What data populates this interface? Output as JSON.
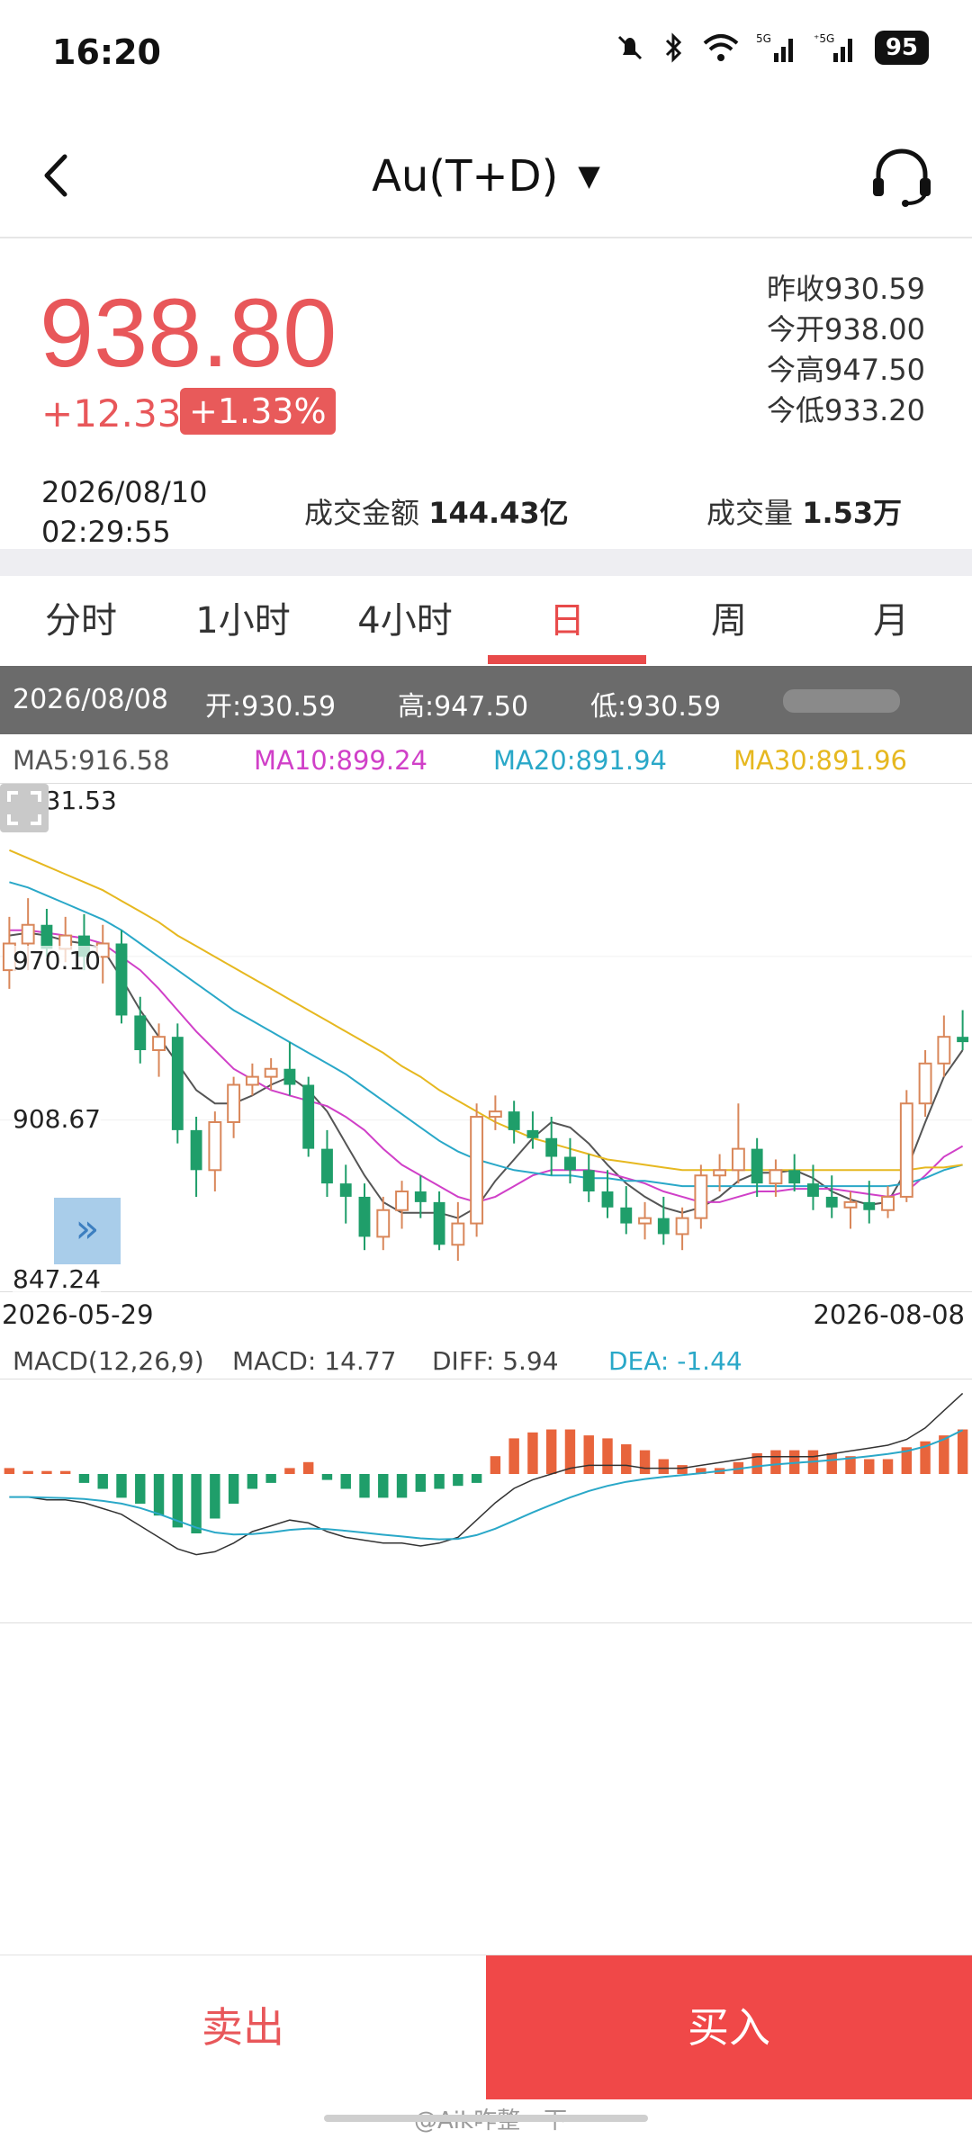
{
  "status_bar": {
    "time": "16:20",
    "battery": "95"
  },
  "header": {
    "title": "Au(T+D)",
    "caret": "▼"
  },
  "quote": {
    "price": "938.80",
    "change": "+12.33",
    "change_pct": "+1.33%",
    "prev_close": "昨收930.59",
    "open": "今开938.00",
    "high": "今高947.50",
    "low": "今低933.20",
    "date": "2026/08/10",
    "time": "02:29:55",
    "amount_label": "成交金额",
    "amount_value": "144.43亿",
    "volume_label": "成交量",
    "volume_value": "1.53万"
  },
  "tabs": [
    {
      "label": "分时"
    },
    {
      "label": "1小时"
    },
    {
      "label": "4小时"
    },
    {
      "label": "日",
      "active": true
    },
    {
      "label": "周"
    },
    {
      "label": "月"
    }
  ],
  "info_bar": {
    "date": "2026/08/08",
    "open": "开:930.59",
    "high": "高:947.50",
    "low": "低:930.59"
  },
  "ma": {
    "ma5": "MA5:916.58",
    "ma10": "MA10:899.24",
    "ma20": "MA20:891.94",
    "ma30": "MA30:891.96",
    "colors": {
      "ma5": "#555555",
      "ma10": "#d040c8",
      "ma20": "#2aa8c8",
      "ma30": "#e6b820"
    }
  },
  "axis": {
    "y_ticks": [
      "1031.53",
      "970.10",
      "908.67",
      "847.24"
    ],
    "x_start": "2026-05-29",
    "x_end": "2026-08-08"
  },
  "macd": {
    "label": "MACD(12,26,9)",
    "macd": "MACD: 14.77",
    "diff": "DIFF: 5.94",
    "dea": "DEA: -1.44"
  },
  "actions": {
    "sell": "卖出",
    "buy": "买入"
  },
  "watermark": "@Aik咋整一下",
  "colors": {
    "up": "#d9875a",
    "down": "#1f9e6a",
    "price": "#e8575a",
    "buy_bg": "#f04848"
  },
  "chart_data": {
    "type": "candlestick",
    "ylim": [
      847.24,
      1031.53
    ],
    "x": [
      "2026-05-29",
      "2026-08-08"
    ],
    "candles": [
      [
        965,
        985,
        958,
        975
      ],
      [
        975,
        992,
        965,
        982
      ],
      [
        982,
        988,
        970,
        973
      ],
      [
        973,
        985,
        968,
        978
      ],
      [
        978,
        986,
        965,
        970
      ],
      [
        970,
        982,
        960,
        975
      ],
      [
        975,
        980,
        945,
        948
      ],
      [
        948,
        955,
        930,
        935
      ],
      [
        935,
        945,
        925,
        940
      ],
      [
        940,
        945,
        900,
        905
      ],
      [
        905,
        910,
        880,
        890
      ],
      [
        890,
        912,
        882,
        908
      ],
      [
        908,
        925,
        902,
        922
      ],
      [
        922,
        930,
        918,
        925
      ],
      [
        925,
        932,
        920,
        928
      ],
      [
        928,
        938,
        918,
        922
      ],
      [
        922,
        925,
        895,
        898
      ],
      [
        898,
        905,
        880,
        885
      ],
      [
        885,
        892,
        870,
        880
      ],
      [
        880,
        885,
        860,
        865
      ],
      [
        865,
        880,
        860,
        875
      ],
      [
        875,
        886,
        868,
        882
      ],
      [
        882,
        888,
        872,
        878
      ],
      [
        878,
        882,
        860,
        862
      ],
      [
        862,
        878,
        856,
        870
      ],
      [
        870,
        915,
        865,
        910
      ],
      [
        910,
        918,
        905,
        912
      ],
      [
        912,
        916,
        900,
        905
      ],
      [
        905,
        912,
        898,
        902
      ],
      [
        902,
        910,
        888,
        895
      ],
      [
        895,
        902,
        885,
        890
      ],
      [
        890,
        896,
        878,
        882
      ],
      [
        882,
        890,
        872,
        876
      ],
      [
        876,
        884,
        866,
        870
      ],
      [
        870,
        878,
        864,
        872
      ],
      [
        872,
        880,
        862,
        866
      ],
      [
        866,
        876,
        860,
        872
      ],
      [
        872,
        892,
        868,
        888
      ],
      [
        888,
        896,
        882,
        890
      ],
      [
        890,
        915,
        885,
        898
      ],
      [
        898,
        902,
        880,
        885
      ],
      [
        885,
        894,
        880,
        890
      ],
      [
        890,
        896,
        882,
        885
      ],
      [
        885,
        892,
        875,
        880
      ],
      [
        880,
        888,
        872,
        876
      ],
      [
        876,
        882,
        868,
        878
      ],
      [
        878,
        886,
        870,
        875
      ],
      [
        875,
        884,
        872,
        880
      ],
      [
        880,
        920,
        878,
        915
      ],
      [
        915,
        935,
        910,
        930
      ],
      [
        930,
        948,
        925,
        940
      ],
      [
        940,
        950,
        935,
        938
      ]
    ],
    "series": [
      {
        "name": "MA5",
        "values": [
          978,
          979,
          978,
          976,
          975,
          973,
          962,
          950,
          940,
          930,
          920,
          915,
          915,
          918,
          922,
          925,
          920,
          912,
          900,
          888,
          878,
          874,
          874,
          874,
          872,
          876,
          886,
          894,
          902,
          908,
          906,
          900,
          892,
          885,
          880,
          876,
          874,
          876,
          880,
          886,
          889,
          889,
          890,
          887,
          882,
          879,
          877,
          878,
          890,
          908,
          925,
          935
        ]
      },
      {
        "name": "MA10",
        "values": [
          980,
          980,
          979,
          978,
          977,
          975,
          970,
          965,
          958,
          950,
          942,
          935,
          928,
          924,
          920,
          918,
          916,
          914,
          910,
          905,
          898,
          892,
          888,
          884,
          880,
          878,
          880,
          884,
          888,
          890,
          890,
          890,
          889,
          887,
          885,
          882,
          880,
          878,
          878,
          880,
          882,
          882,
          883,
          883,
          883,
          882,
          881,
          880,
          882,
          888,
          895,
          899
        ]
      },
      {
        "name": "MA20",
        "values": [
          998,
          996,
          993,
          990,
          987,
          984,
          980,
          975,
          970,
          965,
          960,
          955,
          950,
          946,
          942,
          938,
          934,
          930,
          926,
          921,
          916,
          911,
          906,
          901,
          897,
          894,
          892,
          890,
          889,
          888,
          888,
          887,
          887,
          886,
          886,
          885,
          884,
          884,
          884,
          884,
          884,
          884,
          884,
          884,
          884,
          884,
          884,
          884,
          885,
          887,
          890,
          892
        ]
      },
      {
        "name": "MA30",
        "values": [
          1010,
          1007,
          1004,
          1001,
          998,
          995,
          991,
          987,
          983,
          978,
          974,
          970,
          966,
          962,
          958,
          954,
          950,
          946,
          942,
          938,
          934,
          929,
          925,
          920,
          916,
          912,
          908,
          905,
          902,
          900,
          898,
          896,
          894,
          893,
          892,
          891,
          890,
          890,
          890,
          890,
          890,
          890,
          890,
          890,
          890,
          890,
          890,
          890,
          890,
          891,
          891,
          892
        ]
      }
    ],
    "macd": {
      "hist": [
        2,
        1,
        1,
        1,
        -3,
        -5,
        -8,
        -10,
        -14,
        -18,
        -20,
        -15,
        -10,
        -5,
        -3,
        2,
        4,
        -2,
        -5,
        -8,
        -8,
        -8,
        -6,
        -5,
        -4,
        -3,
        6,
        12,
        14,
        15,
        15,
        13,
        12,
        10,
        8,
        5,
        3,
        2,
        2,
        4,
        7,
        8,
        8,
        8,
        7,
        6,
        5,
        5,
        9,
        11,
        13,
        15
      ],
      "diff": [
        -8,
        -8,
        -9,
        -9,
        -10,
        -12,
        -14,
        -18,
        -22,
        -26,
        -28,
        -27,
        -24,
        -20,
        -18,
        -16,
        -17,
        -20,
        -22,
        -23,
        -24,
        -24,
        -25,
        -24,
        -22,
        -16,
        -10,
        -5,
        -2,
        0,
        2,
        3,
        3,
        3,
        2,
        2,
        2,
        3,
        4,
        5,
        6,
        6,
        6,
        6,
        7,
        8,
        9,
        10,
        12,
        16,
        22,
        28
      ]
    }
  }
}
